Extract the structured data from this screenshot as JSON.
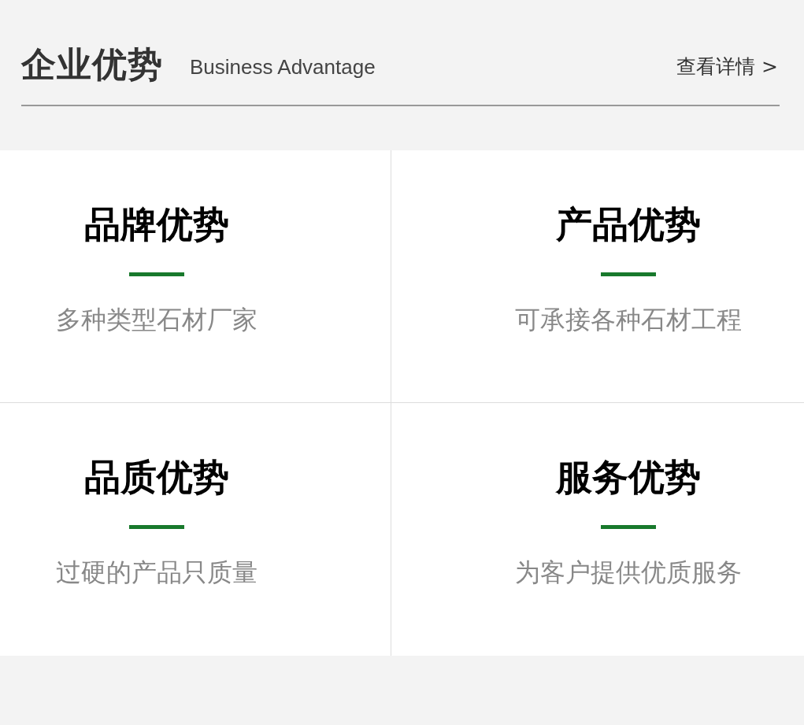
{
  "header": {
    "title": "企业优势",
    "subtitle": "Business Advantage",
    "link": "查看详情 >"
  },
  "items": [
    {
      "title": "品牌优势",
      "description": "多种类型石材厂家"
    },
    {
      "title": "产品优势",
      "description": "可承接各种石材工程"
    },
    {
      "title": "品质优势",
      "description": "过硬的产品只质量"
    },
    {
      "title": "服务优势",
      "description": "为客户提供优质服务"
    }
  ]
}
